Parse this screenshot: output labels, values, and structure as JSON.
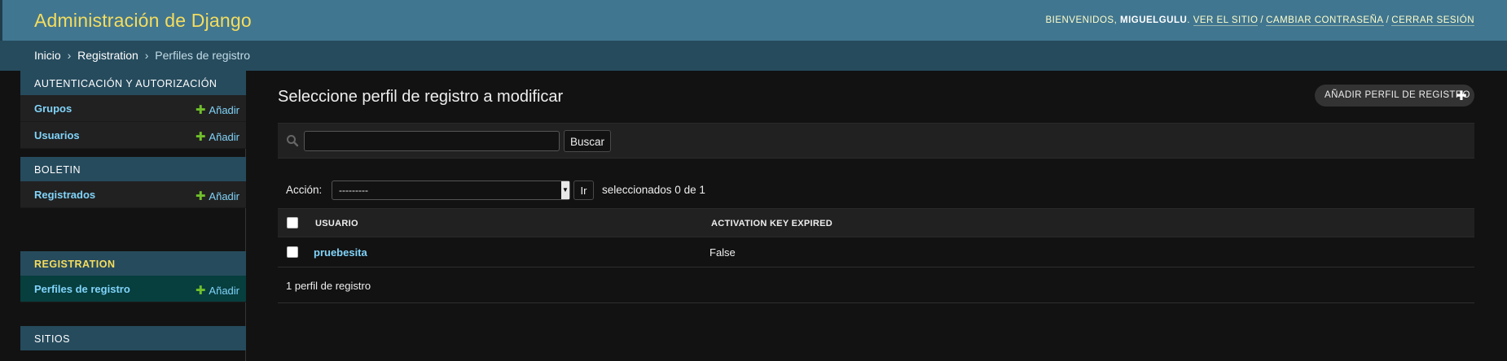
{
  "header": {
    "brand": "Administración de Django",
    "welcome": "Bienvenidos,",
    "username": "MIGUELGULU",
    "view_site": "Ver el sitio",
    "change_password": "Cambiar contraseña",
    "logout": "Cerrar sesión",
    "separator": "/"
  },
  "breadcrumbs": {
    "home": "Inicio",
    "app": "Registration",
    "current": "Perfiles de registro",
    "separator": "›"
  },
  "sidebar": {
    "add_label": "Añadir",
    "modules": [
      {
        "caption": "Autenticación y autorización",
        "items": [
          {
            "label": "Grupos"
          },
          {
            "label": "Usuarios"
          }
        ]
      },
      {
        "caption": "Boletin",
        "items": [
          {
            "label": "Registrados"
          }
        ]
      },
      {
        "caption": "Registration",
        "items": [
          {
            "label": "Perfiles de registro"
          }
        ]
      },
      {
        "caption": "Sitios",
        "items": []
      }
    ]
  },
  "content": {
    "title": "Seleccione perfil de registro a modificar",
    "add_button": "Añadir perfil de registro",
    "search": {
      "value": "",
      "placeholder": "",
      "button": "Buscar"
    },
    "actions": {
      "label": "Acción:",
      "selected": "---------",
      "go": "Ir",
      "counter": "seleccionados 0 de 1"
    },
    "table": {
      "columns": [
        "Usuario",
        "Activation key expired"
      ],
      "rows": [
        {
          "usuario": "pruebesita",
          "activation_key_expired": "False"
        }
      ]
    },
    "paginator": "1 perfil de registro"
  },
  "colors": {
    "header_bg": "#417690",
    "brand": "#f5dd5d",
    "breadcrumbs_bg": "#264b5d",
    "link": "#81d4fa",
    "add_plus": "#70bf2b",
    "current_row_bg": "#073e3e",
    "body_bg": "#121212"
  },
  "icons": [
    "search-icon",
    "plus-icon",
    "chevron-down-icon"
  ]
}
